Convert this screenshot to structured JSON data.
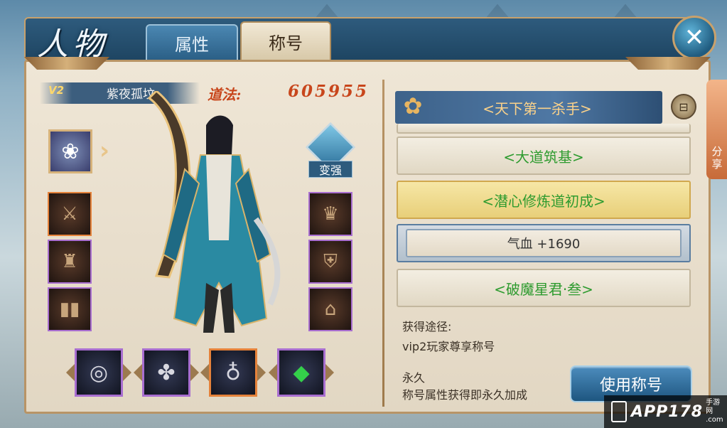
{
  "header": {
    "title": "人物",
    "tabs": [
      {
        "label": "属性",
        "active": false
      },
      {
        "label": "称号",
        "active": true
      }
    ],
    "close_icon": "close-icon"
  },
  "player": {
    "vip": "V2",
    "name": "紫夜孤坟",
    "dao_label": "道法:",
    "dao_value": "605955"
  },
  "change_button": "变强",
  "titles": {
    "current": "<天下第一杀手>",
    "rows": [
      {
        "label": "<大道筑基>",
        "type": "normal"
      },
      {
        "label": "<潜心修炼道初成>",
        "type": "selected"
      },
      {
        "label": "气血 +1690",
        "type": "attr"
      },
      {
        "label": "<破魔星君·叁>",
        "type": "normal"
      }
    ]
  },
  "info": {
    "source_label": "获得途径:",
    "source_value": "vip2玩家尊享称号",
    "duration_label": "永久",
    "duration_value": "称号属性获得即永久加成"
  },
  "use_button": "使用称号",
  "share": "分享",
  "watermark": {
    "main": "APP178",
    "sub_top": "手游网",
    "sub_bottom": ".com"
  },
  "colors": {
    "dao": "#c8461c",
    "title_green": "#2e9b2f",
    "title_gold": "#fbd28a",
    "accent_blue": "#2d5b7d"
  }
}
